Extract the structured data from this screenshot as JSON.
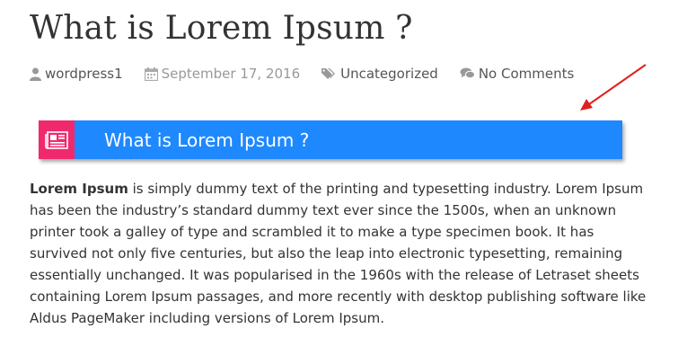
{
  "post": {
    "title": "What is Lorem Ipsum ?",
    "meta": {
      "author": "wordpress1",
      "date": "September 17, 2016",
      "category": "Uncategorized",
      "comments": "No Comments"
    },
    "heading_box": {
      "text": "What is Lorem Ipsum ?",
      "bar_color": "#1e88ff",
      "icon_bg_color": "#f0296e",
      "icon": "newspaper-icon"
    },
    "annotation_arrow_color": "#e02020",
    "body": {
      "lead": "Lorem Ipsum",
      "rest": " is simply dummy text of the printing and typesetting industry. Lorem Ipsum has been the industry’s standard dummy text ever since the 1500s, when an unknown printer took a galley of type and scrambled it to make a type specimen book. It has survived not only five centuries, but also the leap into electronic typesetting, remaining essentially unchanged. It was popularised in the 1960s with the release of Letraset sheets containing Lorem Ipsum passages, and more recently with desktop publishing software like Aldus PageMaker including versions of Lorem Ipsum."
    }
  }
}
